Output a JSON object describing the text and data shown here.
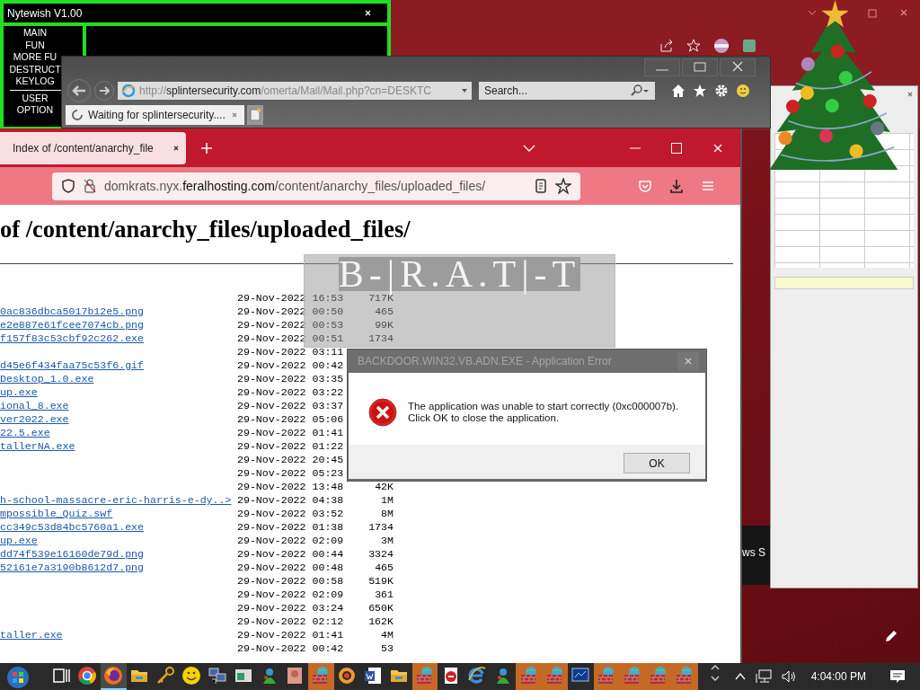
{
  "nytewish": {
    "title": "Nytewish V1.00",
    "menu": [
      "MAIN",
      "FUN",
      "MORE FU",
      "DESTRUCT",
      "KEYLOG"
    ],
    "menu_bottom": [
      "USER",
      "OPTION"
    ]
  },
  "ie": {
    "address": "http://**splintersecurity.com**/omerta/Mail/Mail.php?cn=DESKTC",
    "search": {
      "placeholder": "Search..."
    },
    "tabs": [
      {
        "label": "Waiting for splintersecurity....",
        "selected": true
      }
    ]
  },
  "firefox": {
    "tabs": [
      {
        "label": "Index of /content/anarchy_file",
        "selected": true
      }
    ],
    "address": "domkrats.nyx.**feralhosting.com**/content/anarchy_files/uploaded_files/",
    "heading": "of /content/anarchy_files/uploaded_files/",
    "rows": [
      {
        "date": "29-Nov-2022 16:53",
        "size": "717K"
      },
      {
        "name": "0ac836dbca5017b12e5.png",
        "date": "29-Nov-2022 00:50",
        "size": "465"
      },
      {
        "name": "e2e887e61fcee7074cb.png",
        "date": "29-Nov-2022 00:53",
        "size": "99K"
      },
      {
        "name": "f157f83c53cbf92c262.exe",
        "date": "29-Nov-2022 00:51",
        "size": "1734"
      },
      {
        "date": "29-Nov-2022 03:11"
      },
      {
        "name": "d45e6f434faa75c53f6.gif",
        "date": "29-Nov-2022 00:42"
      },
      {
        "name": "Desktop_1.0.exe",
        "date": "29-Nov-2022 03:35"
      },
      {
        "name": "up.exe",
        "date": "29-Nov-2022 03:22"
      },
      {
        "name": "ional_8.exe",
        "date": "29-Nov-2022 03:37"
      },
      {
        "name": "ver2022.exe",
        "date": "29-Nov-2022 05:06"
      },
      {
        "name": "22.5.exe",
        "date": "29-Nov-2022 01:41"
      },
      {
        "name": "tallerNA.exe",
        "date": "29-Nov-2022 01:22"
      },
      {
        "date": "29-Nov-2022 20:45"
      },
      {
        "date": "29-Nov-2022 05:23"
      },
      {
        "date": "29-Nov-2022 13:48",
        "size": "42K"
      },
      {
        "name": "h-school-massacre-eric-harris-e-dy..>",
        "date": "29-Nov-2022 04:38",
        "size": "1M"
      },
      {
        "name": "mpossible_Quiz.swf",
        "date": "29-Nov-2022 03:52",
        "size": "8M"
      },
      {
        "name": "cc349c53d84bc5760a1.exe",
        "date": "29-Nov-2022 01:38",
        "size": "1734"
      },
      {
        "name": "up.exe",
        "date": "29-Nov-2022 02:09",
        "size": "3M"
      },
      {
        "name": "dd74f539e16160de79d.png",
        "date": "29-Nov-2022 00:44",
        "size": "3324"
      },
      {
        "name": "52161e7a3190b8612d7.png",
        "date": "29-Nov-2022 00:48",
        "size": "465"
      },
      {
        "date": "29-Nov-2022 00:58",
        "size": "519K"
      },
      {
        "date": "29-Nov-2022 02:09",
        "size": "361"
      },
      {
        "date": "29-Nov-2022 03:24",
        "size": "650K"
      },
      {
        "date": "29-Nov-2022 02:12",
        "size": "162K"
      },
      {
        "name": "taller.exe",
        "date": "29-Nov-2022 01:41",
        "size": "4M"
      },
      {
        "date": "29-Nov-2022 00:42",
        "size": "53"
      }
    ]
  },
  "banner": "B-|R.A.T|-T",
  "error_dialog": {
    "title": "BACKDOOR.WIN32.VB.ADN.EXE - Application Error",
    "message": "The application was unable to start correctly (0xc000007b).\nClick OK to close the application.",
    "button": "OK"
  },
  "side_strip": "ws S",
  "taskbar": {
    "items": [
      {
        "kind": "taskview",
        "highlighted": false,
        "active": false
      },
      {
        "kind": "chrome",
        "highlighted": false,
        "active": false
      },
      {
        "kind": "firefox",
        "highlighted": false,
        "active": true
      },
      {
        "kind": "folder",
        "highlighted": false,
        "active": false
      },
      {
        "kind": "key",
        "highlighted": false,
        "active": false
      },
      {
        "kind": "smiley",
        "highlighted": false,
        "active": false
      },
      {
        "kind": "computers",
        "highlighted": false,
        "active": false
      },
      {
        "kind": "window",
        "highlighted": false,
        "active": false
      },
      {
        "kind": "figure",
        "highlighted": false,
        "active": false
      },
      {
        "kind": "photo",
        "highlighted": false,
        "active": false
      },
      {
        "kind": "firewall",
        "highlighted": true,
        "active": false
      },
      {
        "kind": "sun",
        "highlighted": false,
        "active": false
      },
      {
        "kind": "document",
        "highlighted": false,
        "active": false
      },
      {
        "kind": "folder",
        "highlighted": false,
        "active": false
      },
      {
        "kind": "firewall",
        "highlighted": true,
        "active": false
      },
      {
        "kind": "pdf",
        "highlighted": false,
        "active": false
      },
      {
        "kind": "ie",
        "highlighted": false,
        "active": false
      },
      {
        "kind": "figure",
        "highlighted": false,
        "active": false
      },
      {
        "kind": "firewall",
        "highlighted": true,
        "active": false
      },
      {
        "kind": "firewall",
        "highlighted": true,
        "active": false
      },
      {
        "kind": "monitor",
        "highlighted": false,
        "active": false
      },
      {
        "kind": "firewall",
        "highlighted": true,
        "active": false
      },
      {
        "kind": "firewall",
        "highlighted": true,
        "active": false
      },
      {
        "kind": "firewall",
        "highlighted": true,
        "active": false
      },
      {
        "kind": "firewall",
        "highlighted": true,
        "active": false
      }
    ],
    "clock": "4:04:00 PM"
  }
}
